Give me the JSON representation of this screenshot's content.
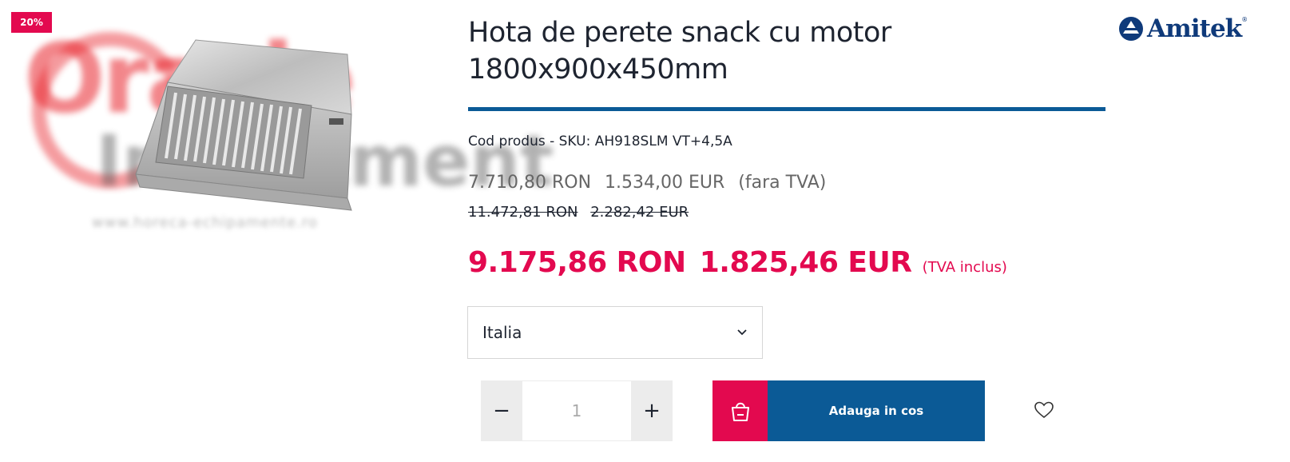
{
  "badge": {
    "discount": "20%"
  },
  "image": {
    "watermark": {
      "line1": "Oracle",
      "line2": "Inventment",
      "url": "www.horeca-echipamente.ro"
    }
  },
  "brand": {
    "logo_text": "Amitek",
    "reg_mark": "®"
  },
  "product": {
    "title_line1": "Hota de perete snack cu motor",
    "title_line2": "1800x900x450mm",
    "sku": "Cod produs - SKU: AH918SLM VT+4,5A"
  },
  "prices": {
    "net_ron": "7.710,80 RON",
    "net_eur": "1.534,00 EUR",
    "net_note": "(fara TVA)",
    "old_ron": "11.472,81 RON",
    "old_eur": "2.282,42 EUR",
    "gross_ron": "9.175,86 RON",
    "gross_eur": "1.825,46 EUR",
    "gross_note": "(TVA inclus)"
  },
  "variant_select": {
    "selected": "Italia"
  },
  "quantity": {
    "minus": "−",
    "value": "1",
    "plus": "+"
  },
  "cart": {
    "label": "Adauga in cos"
  },
  "colors": {
    "accent_red": "#e3094f",
    "primary_blue": "#0b5a96",
    "logo_blue": "#0f3a7a"
  },
  "icons": [
    "chevron-down-icon",
    "shopping-bag-icon",
    "heart-icon",
    "amitek-logo-icon"
  ]
}
